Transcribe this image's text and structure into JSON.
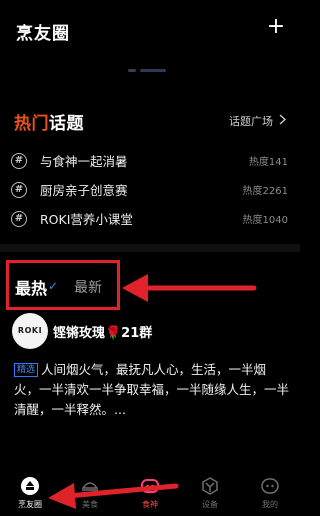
{
  "header": {
    "title": "烹友圈",
    "add_label": "+"
  },
  "hot_topics": {
    "title_highlight": "热门",
    "title_rest": "话题",
    "square_link": "话题广场",
    "items": [
      {
        "name": "与食神一起消暑",
        "heat": "热度141"
      },
      {
        "name": "厨房亲子创意赛",
        "heat": "热度2261"
      },
      {
        "name": "ROKI营养小课堂",
        "heat": "热度1040"
      }
    ]
  },
  "feed_tabs": {
    "hot": "最热",
    "new": "最新"
  },
  "post": {
    "avatar_text": "ROKI",
    "author": "铿锵玫瑰🌹21群",
    "tag": "精选",
    "text": "人间烟火气，最抚凡人心，生活，一半烟火，一半清欢一半争取幸福，一半随缘人生，一半清醒，一半释然。..."
  },
  "tabbar": {
    "items": [
      {
        "label": "烹友圈",
        "icon": "home-icon",
        "active": true
      },
      {
        "label": "美食",
        "icon": "food-icon",
        "active": false
      },
      {
        "label": "食神",
        "icon": "chef-icon",
        "active": false
      },
      {
        "label": "设备",
        "icon": "device-icon",
        "active": false
      },
      {
        "label": "我的",
        "icon": "profile-icon",
        "active": false
      }
    ]
  },
  "colors": {
    "accent_orange": "#e8521d",
    "annotation_red": "#e0232a",
    "tag_blue": "#2f7bff"
  }
}
